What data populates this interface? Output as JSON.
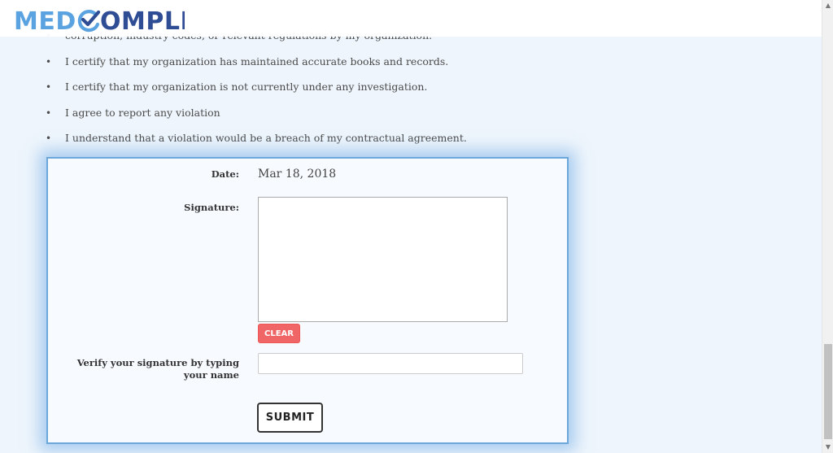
{
  "header": {
    "logo_text": "MEDCOMPLI"
  },
  "certifications": [
    "corruption, industry codes, or relevant regulations by my organization.",
    "I certify that my organization has maintained accurate books and records.",
    "I certify that my organization is not currently under any investigation.",
    "I agree to report any violation",
    "I understand that a violation would be a breach of my contractual agreement."
  ],
  "form": {
    "date_label": "Date:",
    "date_value": "Mar 18, 2018",
    "signature_label": "Signature:",
    "clear_label": "CLEAR",
    "verify_label": "Verify your signature by typing your name",
    "verify_value": "",
    "submit_label": "SUBMIT"
  },
  "colors": {
    "logo_light": "#5aa3e0",
    "logo_dark": "#2f4d95",
    "clear_button": "#f06565",
    "card_border": "#6ca7dc"
  },
  "icons": {
    "scroll_up": "triangle-up",
    "scroll_down": "triangle-down",
    "logo_check": "checkmark-circle"
  }
}
